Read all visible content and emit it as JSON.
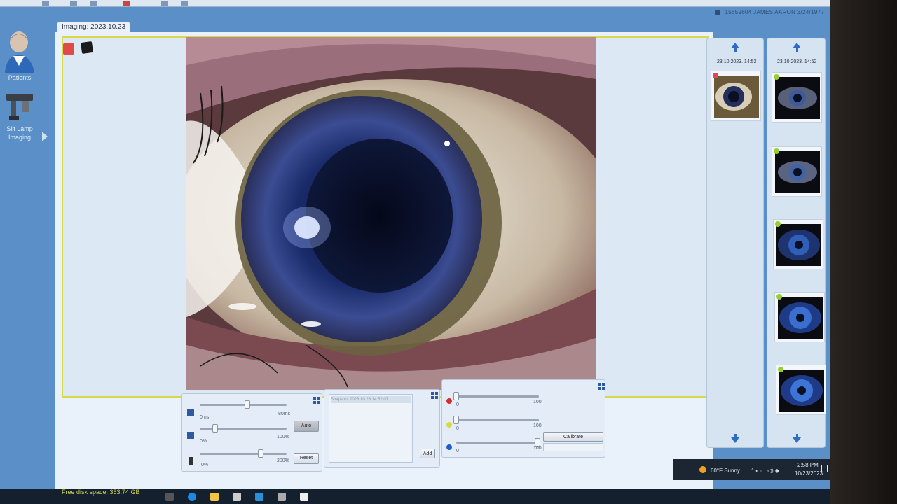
{
  "header": {
    "patient_info": "15659604  JAMES  AARON  3/24/1977"
  },
  "nav": {
    "items": [
      {
        "label": "Patients"
      },
      {
        "label": "Slit Lamp\nImaging"
      }
    ]
  },
  "imaging_tab": "Imaging: 2023.10.23",
  "controls": {
    "exposure": {
      "min": "0ms",
      "max": "80ms",
      "value": 0.55
    },
    "gain": {
      "min": "0%",
      "max": "100%",
      "value": 0.18
    },
    "gamma": {
      "min": "0%",
      "max": "200%",
      "value": 0.7
    },
    "auto_label": "Auto",
    "reset_label": "Reset",
    "add_label": "Add",
    "preset_placeholder": "Snapshot 2023.10.23 14:52:07",
    "rgb": [
      {
        "color": "#d32f2f",
        "min": "0",
        "max": "100",
        "value": 0.0
      },
      {
        "color": "#d7d84a",
        "min": "0",
        "max": "100",
        "value": 0.0
      },
      {
        "color": "#1e5fd0",
        "min": "0",
        "max": "100",
        "value": 0.98
      }
    ],
    "calibrate_label": "Calibrate"
  },
  "thumbnails": {
    "col1_date": "23.10.2023. 14:52",
    "col2_date": "23.10.2023. 14:52"
  },
  "status": {
    "free_disk": "Free disk space: 353.74 GB"
  },
  "tray": {
    "weather": "60°F  Sunny",
    "time": "2:58 PM",
    "date": "10/23/2023"
  }
}
